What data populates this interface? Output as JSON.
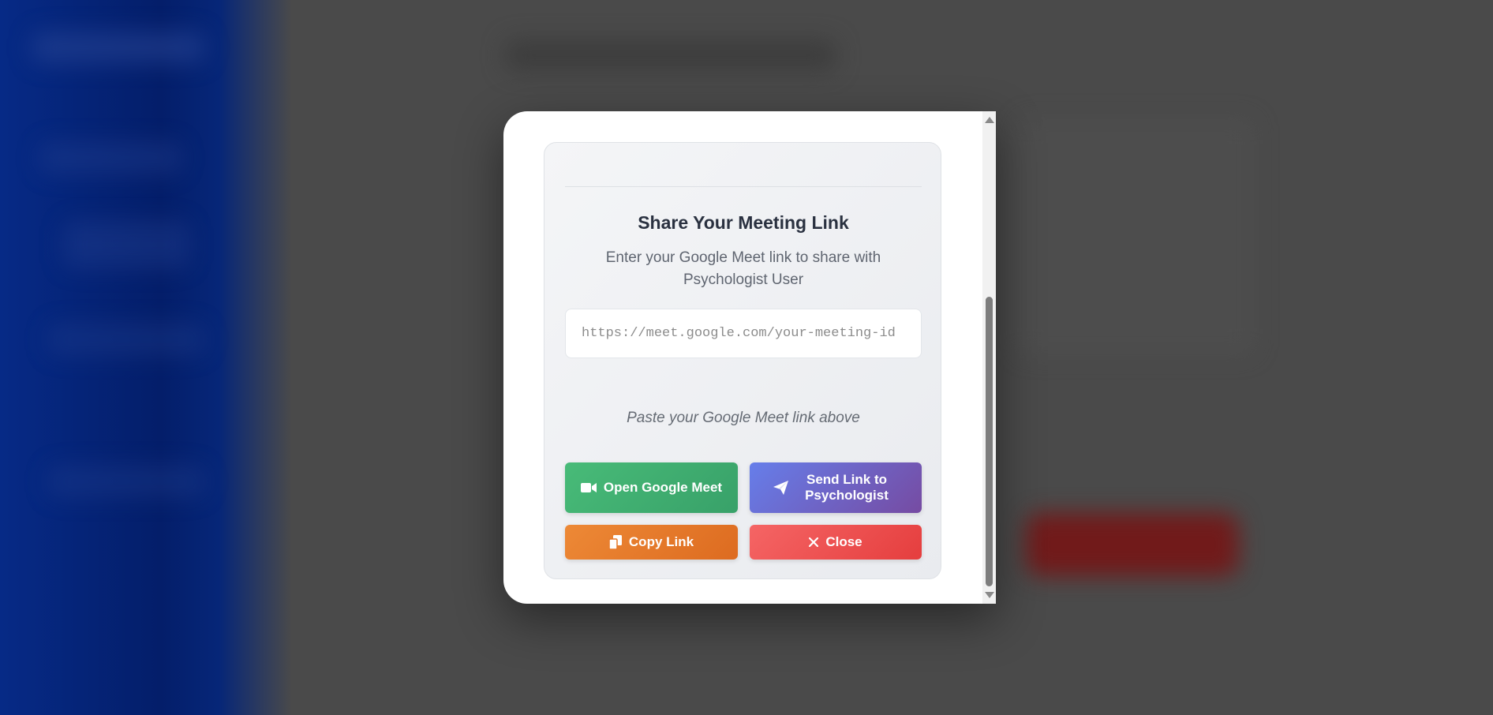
{
  "modal": {
    "title": "Share Your Meeting Link",
    "subtitle": "Enter your Google Meet link to share with Psychologist User",
    "input": {
      "value": "",
      "placeholder": "https://meet.google.com/your-meeting-id"
    },
    "hint": "Paste your Google Meet link above",
    "buttons": {
      "open_meet": {
        "label": "Open Google Meet",
        "icon": "video-camera-icon",
        "color": "#48bb78"
      },
      "send_link": {
        "label": "Send Link to Psychologist",
        "icon": "paper-plane-icon",
        "color": "#667eea"
      },
      "copy_link": {
        "label": "Copy Link",
        "icon": "copy-icon",
        "color": "#ed8936"
      },
      "close": {
        "label": "Close",
        "icon": "close-icon",
        "color": "#f56565"
      }
    }
  }
}
